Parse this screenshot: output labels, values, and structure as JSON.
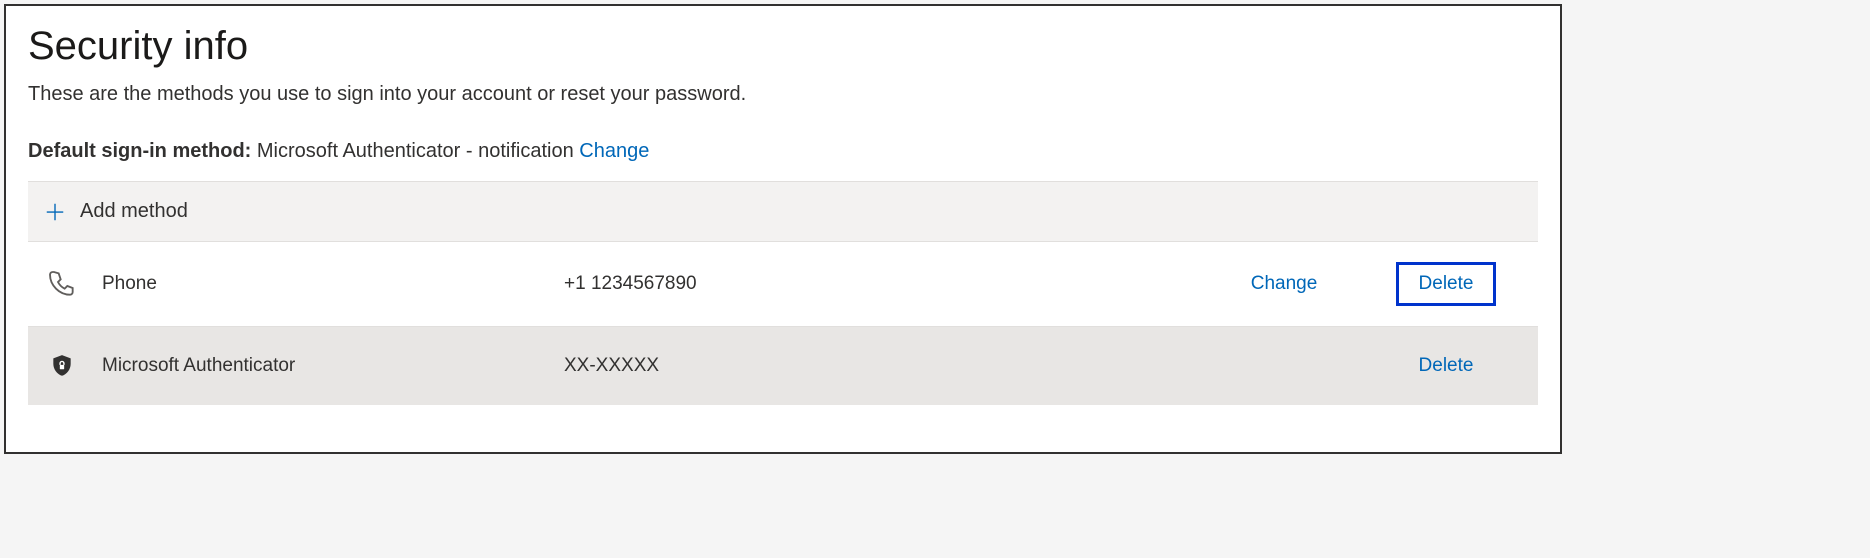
{
  "header": {
    "title": "Security info",
    "subtitle": "These are the methods you use to sign into your account or reset your password."
  },
  "defaultMethod": {
    "label": "Default sign-in method:",
    "value": "Microsoft Authenticator - notification",
    "changeLabel": "Change"
  },
  "addMethod": {
    "label": "Add method"
  },
  "methods": [
    {
      "icon": "phone-icon",
      "name": "Phone",
      "value": "+1 1234567890",
      "changeLabel": "Change",
      "deleteLabel": "Delete"
    },
    {
      "icon": "authenticator-icon",
      "name": "Microsoft Authenticator",
      "value": "XX-XXXXX",
      "deleteLabel": "Delete"
    }
  ]
}
